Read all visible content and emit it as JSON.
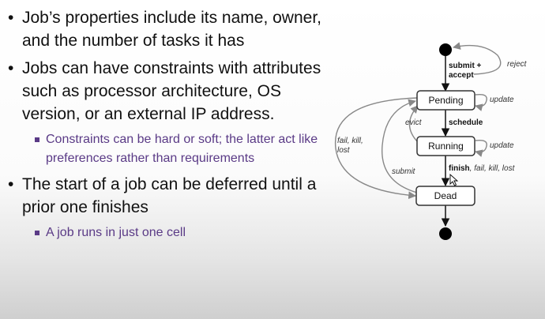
{
  "bullets": [
    {
      "text": "Job’s properties include its name, owner, and the number of tasks it has"
    },
    {
      "text": "Jobs can have constraints with attributes such as processor architecture, OS version, or an external IP address."
    },
    {
      "sub": "Constraints can be hard or soft; the latter act like preferences rather than requirements"
    },
    {
      "text": "The start of a job can be deferred until a prior one finishes"
    },
    {
      "sub": "A job runs in just one cell"
    }
  ],
  "diagram": {
    "states": {
      "pending": "Pending",
      "running": "Running",
      "dead": "Dead"
    },
    "transitions": {
      "submit_accept_1": "submit +",
      "submit_accept_2": "accept",
      "reject": "reject",
      "update_pending": "update",
      "update_running": "update",
      "evict": "evict",
      "schedule": "schedule",
      "fail_kill_lost_1": "fail, kill,",
      "fail_kill_lost_2": "lost",
      "submit": "submit",
      "finish": "finish",
      "finish_rest": ", fail, kill, lost"
    }
  }
}
